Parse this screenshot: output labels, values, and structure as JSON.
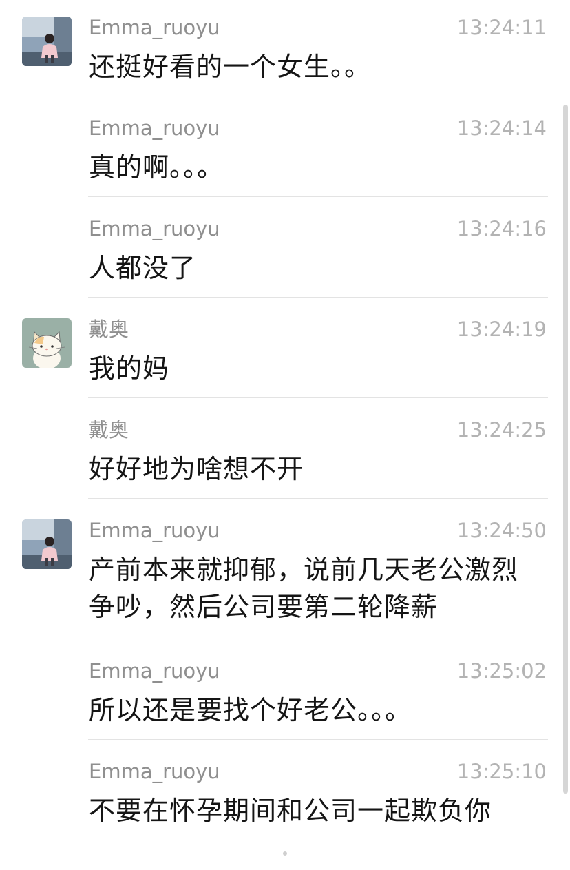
{
  "messages": [
    {
      "sender": "Emma_ruoyu",
      "time": "13:24:11",
      "text": "还挺好看的一个女生。。",
      "avatar": "photo-avatar"
    },
    {
      "sender": "Emma_ruoyu",
      "time": "13:24:14",
      "text": "真的啊。。。"
    },
    {
      "sender": "Emma_ruoyu",
      "time": "13:24:16",
      "text": "人都没了"
    },
    {
      "sender": "戴奥",
      "time": "13:24:19",
      "text": "我的妈",
      "avatar": "cat-avatar"
    },
    {
      "sender": "戴奥",
      "time": "13:24:25",
      "text": "好好地为啥想不开"
    },
    {
      "sender": "Emma_ruoyu",
      "time": "13:24:50",
      "text": "产前本来就抑郁，说前几天老公激烈争吵，然后公司要第二轮降薪",
      "avatar": "photo-avatar"
    },
    {
      "sender": "Emma_ruoyu",
      "time": "13:25:02",
      "text": "所以还是要找个好老公。。。"
    },
    {
      "sender": "Emma_ruoyu",
      "time": "13:25:10",
      "text": "不要在怀孕期间和公司一起欺负你"
    }
  ],
  "colors": {
    "sender": "#8f8f8f",
    "time": "#b3b3b3",
    "text": "#151515",
    "divider": "#e3e3e3"
  }
}
